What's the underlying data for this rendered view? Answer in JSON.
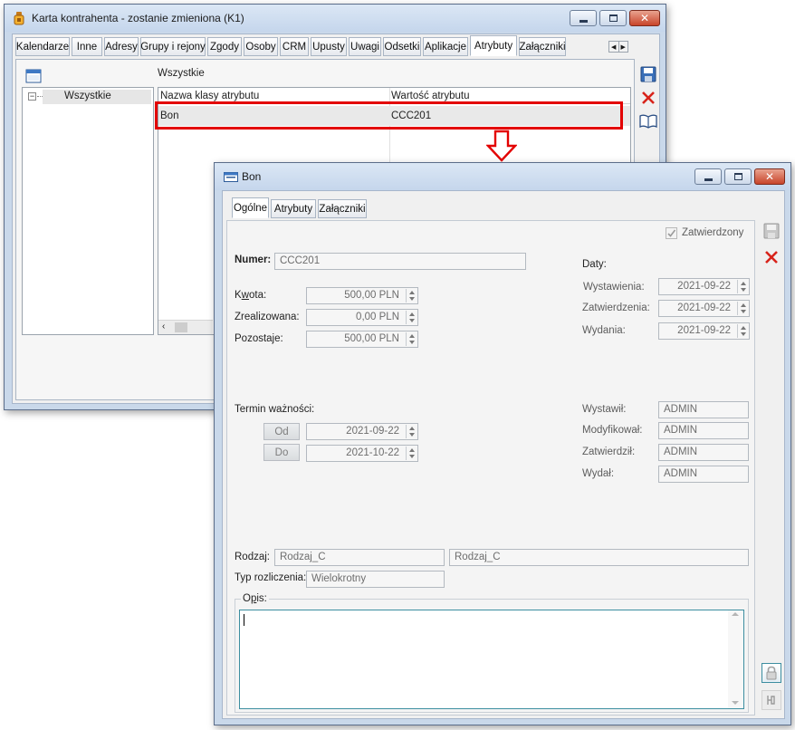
{
  "back_window": {
    "title": "Karta kontrahenta - zostanie zmieniona (K1)",
    "tabs": [
      "Kalendarze",
      "Inne",
      "Adresy",
      "Grupy i rejony",
      "Zgody",
      "Osoby",
      "CRM",
      "Upusty",
      "Uwagi",
      "Odsetki",
      "Aplikacje",
      "Atrybuty",
      "Załączniki"
    ],
    "active_tab": "Atrybuty",
    "tree": {
      "root": "Wszystkie"
    },
    "grid": {
      "caption": "Wszystkie",
      "headers": [
        "Nazwa klasy atrybutu",
        "Wartość atrybutu"
      ],
      "rows": [
        {
          "name": "Bon",
          "value": "CCC201"
        }
      ]
    }
  },
  "front_window": {
    "title": "Bon",
    "tabs": [
      "Ogólne",
      "Atrybuty",
      "Załączniki"
    ],
    "active_tab": "Ogólne",
    "zatwierdzony": {
      "label": "Zatwierdzony",
      "checked": true
    },
    "numer": {
      "label": "Numer:",
      "value": "CCC201"
    },
    "kwota": {
      "label_pre": "K",
      "label_u": "w",
      "label_post": "ota:",
      "value": "500,00 PLN"
    },
    "zrealizowana": {
      "label": "Zrealizowana:",
      "value": "0,00 PLN"
    },
    "pozostaje": {
      "label": "Pozostaje:",
      "value": "500,00 PLN"
    },
    "daty": {
      "label": "Daty:",
      "wystawienia": {
        "label": "Wystawienia:",
        "value": "2021-09-22"
      },
      "zatwierdzenia": {
        "label": "Zatwierdzenia:",
        "value": "2021-09-22"
      },
      "wydania": {
        "label": "Wydania:",
        "value": "2021-09-22"
      }
    },
    "termin": {
      "label": "Termin ważności:",
      "od": {
        "label": "Od",
        "value": "2021-09-22"
      },
      "do": {
        "label": "Do",
        "value": "2021-10-22"
      }
    },
    "osoby": {
      "wystawil": {
        "label": "Wystawił:",
        "value": "ADMIN"
      },
      "modyfikowal": {
        "label": "Modyfikował:",
        "value": "ADMIN"
      },
      "zatwierdzil": {
        "label": "Zatwierdził:",
        "value": "ADMIN"
      },
      "wydal": {
        "label": "Wydał:",
        "value": "ADMIN"
      }
    },
    "rodzaj": {
      "label": "Rodzaj:",
      "value": "Rodzaj_C",
      "value2": "Rodzaj_C"
    },
    "typ_rozliczenia": {
      "label": "Typ rozliczenia:",
      "value": "Wielokrotny"
    },
    "opis": {
      "label_pre": "O",
      "label_u": "p",
      "label_post": "is:",
      "value": ""
    }
  },
  "colors": {
    "highlight": "#e30000",
    "accent": "#2d6fc0"
  }
}
